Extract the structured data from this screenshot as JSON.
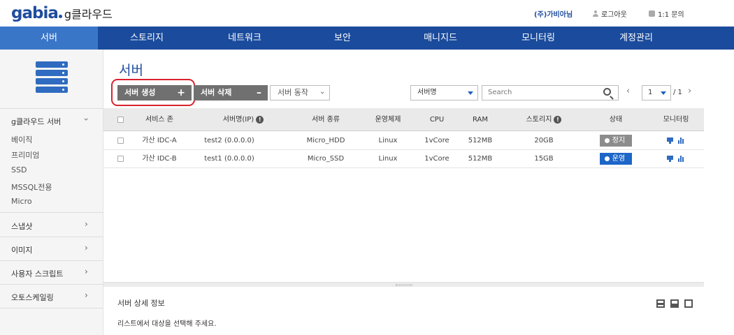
{
  "header": {
    "logo_brand": "gabia",
    "logo_sub": "g클라우드",
    "company": "(주)가비아님",
    "logout": "로그아웃",
    "inquiry": "1:1 문의"
  },
  "nav": [
    "서버",
    "스토리지",
    "네트워크",
    "보안",
    "매니지드",
    "모니터링",
    "계정관리"
  ],
  "sidebar": {
    "group_title": "g클라우드 서버",
    "items": [
      "베이직",
      "프리미엄",
      "SSD",
      "MSSQL전용",
      "Micro"
    ],
    "sections": [
      "스냅샷",
      "이미지",
      "사용자 스크립트",
      "오토스케일링"
    ]
  },
  "main": {
    "title": "서버",
    "create_label": "서버 생성",
    "create_symbol": "+",
    "delete_label": "서버 삭제",
    "delete_symbol": "–",
    "action_label": "서버 동작",
    "filter_selected": "서버명",
    "search_placeholder": "Search",
    "page_current": "1",
    "page_total": "/ 1"
  },
  "table": {
    "headers": {
      "zone": "서비스 존",
      "name": "서버명(IP)",
      "type": "서버 종류",
      "os": "운영체제",
      "cpu": "CPU",
      "ram": "RAM",
      "storage": "스토리지",
      "status": "상태",
      "monitoring": "모니터링"
    },
    "rows": [
      {
        "zone": "가산 IDC-A",
        "name": "test2 (0.0.0.0)",
        "type": "Micro_HDD",
        "os": "Linux",
        "cpu": "1vCore",
        "ram": "512MB",
        "storage": "20GB",
        "status": "정지"
      },
      {
        "zone": "가산 IDC-B",
        "name": "test1 (0.0.0.0)",
        "type": "Micro_SSD",
        "os": "Linux",
        "cpu": "1vCore",
        "ram": "512MB",
        "storage": "15GB",
        "status": "운영"
      }
    ]
  },
  "details": {
    "title": "서버 상세 정보",
    "message": "리스트에서 대상을 선택해 주세요."
  },
  "colors": {
    "nav_bg": "#1a4b9c",
    "nav_active": "#3a76c8",
    "status_stopped": "#8c8c8c",
    "status_running": "#1e66c8",
    "highlight": "#d9232d"
  }
}
